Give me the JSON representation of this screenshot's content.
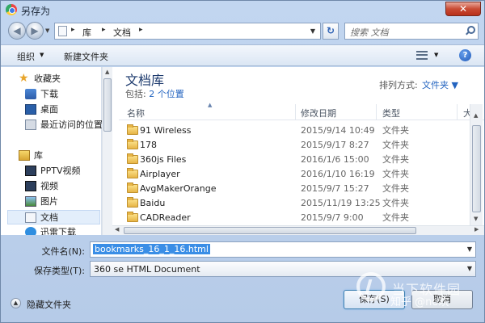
{
  "window": {
    "title": "另存为",
    "close_glyph": "✕"
  },
  "address": {
    "back_glyph": "◀",
    "forward_glyph": "▶",
    "crumbs": [
      "库",
      "文档"
    ],
    "sep": "▸",
    "dd_glyph": "▼",
    "refresh_glyph": "↻",
    "search_placeholder": "搜索 文档"
  },
  "toolbar": {
    "organize": "组织",
    "new_folder": "新建文件夹",
    "help": "?",
    "dd_glyph": "▼"
  },
  "nav": {
    "items": [
      {
        "label": "收藏夹",
        "icon": "star-icon"
      },
      {
        "label": "下载",
        "icon": "download-icon"
      },
      {
        "label": "桌面",
        "icon": "desktop-icon"
      },
      {
        "label": "最近访问的位置",
        "icon": "recent-places-icon"
      },
      {
        "label": "库",
        "icon": "library-icon"
      },
      {
        "label": "PPTV视频",
        "icon": "video-icon"
      },
      {
        "label": "视频",
        "icon": "video-icon"
      },
      {
        "label": "图片",
        "icon": "picture-icon"
      },
      {
        "label": "文档",
        "icon": "document-icon",
        "selected": true
      },
      {
        "label": "迅雷下载",
        "icon": "xunlei-icon"
      }
    ]
  },
  "library": {
    "title": "文档库",
    "includes_label": "包括:",
    "includes_link": "2 个位置",
    "arrange_label": "排列方式:",
    "arrange_value": "文件夹 ▼"
  },
  "columns": [
    "名称",
    "修改日期",
    "类型",
    "大"
  ],
  "files": [
    {
      "name": "91 Wireless",
      "date": "2015/9/14 10:49",
      "type": "文件夹"
    },
    {
      "name": "178",
      "date": "2015/9/17 8:27",
      "type": "文件夹"
    },
    {
      "name": "360js Files",
      "date": "2016/1/6 15:00",
      "type": "文件夹"
    },
    {
      "name": "Airplayer",
      "date": "2016/1/10 16:19",
      "type": "文件夹"
    },
    {
      "name": "AvgMakerOrange",
      "date": "2015/9/7 15:27",
      "type": "文件夹"
    },
    {
      "name": "Baidu",
      "date": "2015/11/19 13:25",
      "type": "文件夹"
    },
    {
      "name": "CADReader",
      "date": "2015/9/7 9:00",
      "type": "文件夹"
    }
  ],
  "form": {
    "filename_label": "文件名(N):",
    "filename_value": "bookmarks_16_1_16.html",
    "savetype_label": "保存类型(T):",
    "savetype_value": "360 se HTML Document",
    "hide_folders": "隐藏文件夹",
    "save_button": "保存(S)",
    "cancel_button": "取消"
  },
  "watermark": {
    "line1": "当下软件园",
    "line2": "知乎 @no欢"
  }
}
